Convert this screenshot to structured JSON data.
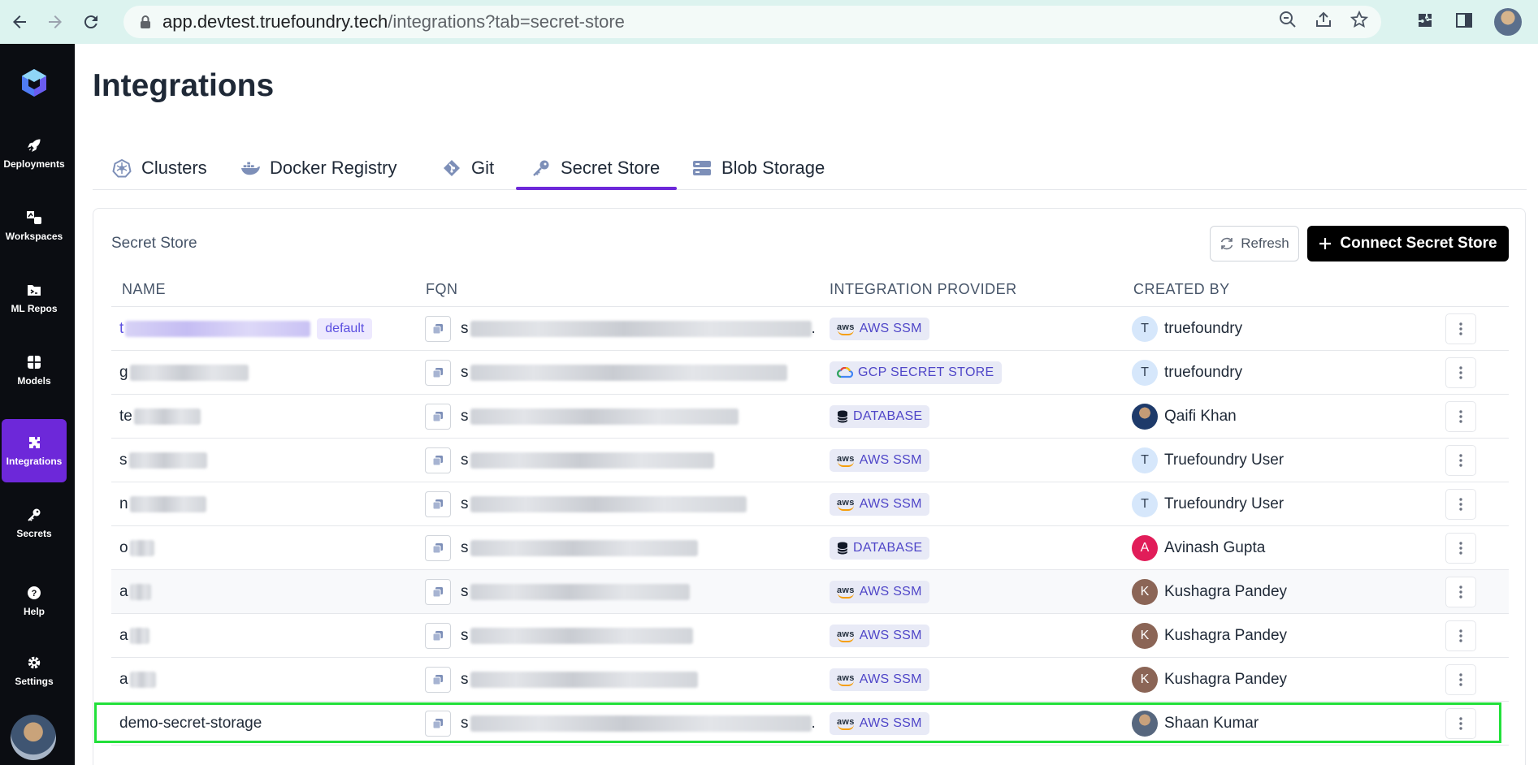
{
  "browser": {
    "url_host": "app.devtest.truefoundry.tech",
    "url_path": "/integrations?tab=secret-store"
  },
  "sidebar": {
    "items": [
      {
        "label": "Deployments",
        "icon": "rocket-icon"
      },
      {
        "label": "Workspaces",
        "icon": "workspaces-icon"
      },
      {
        "label": "ML Repos",
        "icon": "ml-repos-icon"
      },
      {
        "label": "Models",
        "icon": "models-icon"
      },
      {
        "label": "Integrations",
        "icon": "puzzle-icon",
        "active": true
      },
      {
        "label": "Secrets",
        "icon": "key-icon"
      },
      {
        "label": "Help",
        "icon": "help-icon"
      },
      {
        "label": "Settings",
        "icon": "gear-icon"
      }
    ]
  },
  "page": {
    "title": "Integrations"
  },
  "tabs": [
    {
      "label": "Clusters",
      "icon": "helm-icon"
    },
    {
      "label": "Docker Registry",
      "icon": "docker-icon"
    },
    {
      "label": "Git",
      "icon": "git-icon"
    },
    {
      "label": "Secret Store",
      "icon": "key-icon",
      "active": true
    },
    {
      "label": "Blob Storage",
      "icon": "storage-icon"
    }
  ],
  "card": {
    "title": "Secret Store",
    "refresh_label": "Refresh",
    "connect_label": "Connect Secret Store"
  },
  "table": {
    "columns": [
      "NAME",
      "FQN",
      "INTEGRATION PROVIDER",
      "CREATED BY"
    ],
    "rows": [
      {
        "name_prefix": "t",
        "default_badge": "default",
        "fqn_prefix": "s",
        "fqn_suffix": ".",
        "provider": "AWS SSM",
        "creator": "truefoundry",
        "creator_initial": "T"
      },
      {
        "name_prefix": "g",
        "fqn_prefix": "s",
        "provider": "GCP SECRET STORE",
        "creator": "truefoundry",
        "creator_initial": "T"
      },
      {
        "name_prefix": "te",
        "fqn_prefix": "s",
        "provider": "DATABASE",
        "creator": "Qaifi Khan",
        "creator_initial": ""
      },
      {
        "name_prefix": "s",
        "fqn_prefix": "s",
        "provider": "AWS SSM",
        "creator": "Truefoundry User",
        "creator_initial": "T"
      },
      {
        "name_prefix": "n",
        "fqn_prefix": "s",
        "provider": "AWS SSM",
        "creator": "Truefoundry User",
        "creator_initial": "T"
      },
      {
        "name_prefix": "o",
        "fqn_prefix": "s",
        "provider": "DATABASE",
        "creator": "Avinash Gupta",
        "creator_initial": "A"
      },
      {
        "name_prefix": "a",
        "fqn_prefix": "s",
        "provider": "AWS SSM",
        "creator": "Kushagra Pandey",
        "creator_initial": "K"
      },
      {
        "name_prefix": "a",
        "fqn_prefix": "s",
        "provider": "AWS SSM",
        "creator": "Kushagra Pandey",
        "creator_initial": "K"
      },
      {
        "name_prefix": "a",
        "fqn_prefix": "s",
        "provider": "AWS SSM",
        "creator": "Kushagra Pandey",
        "creator_initial": "K"
      },
      {
        "name_prefix": "demo-secret-storage",
        "fqn_prefix": "s",
        "fqn_suffix": ".",
        "provider": "AWS SSM",
        "creator": "Shaan Kumar",
        "creator_initial": ""
      }
    ]
  },
  "colors": {
    "accent": "#6d28d9",
    "highlight": "#22e03a"
  }
}
